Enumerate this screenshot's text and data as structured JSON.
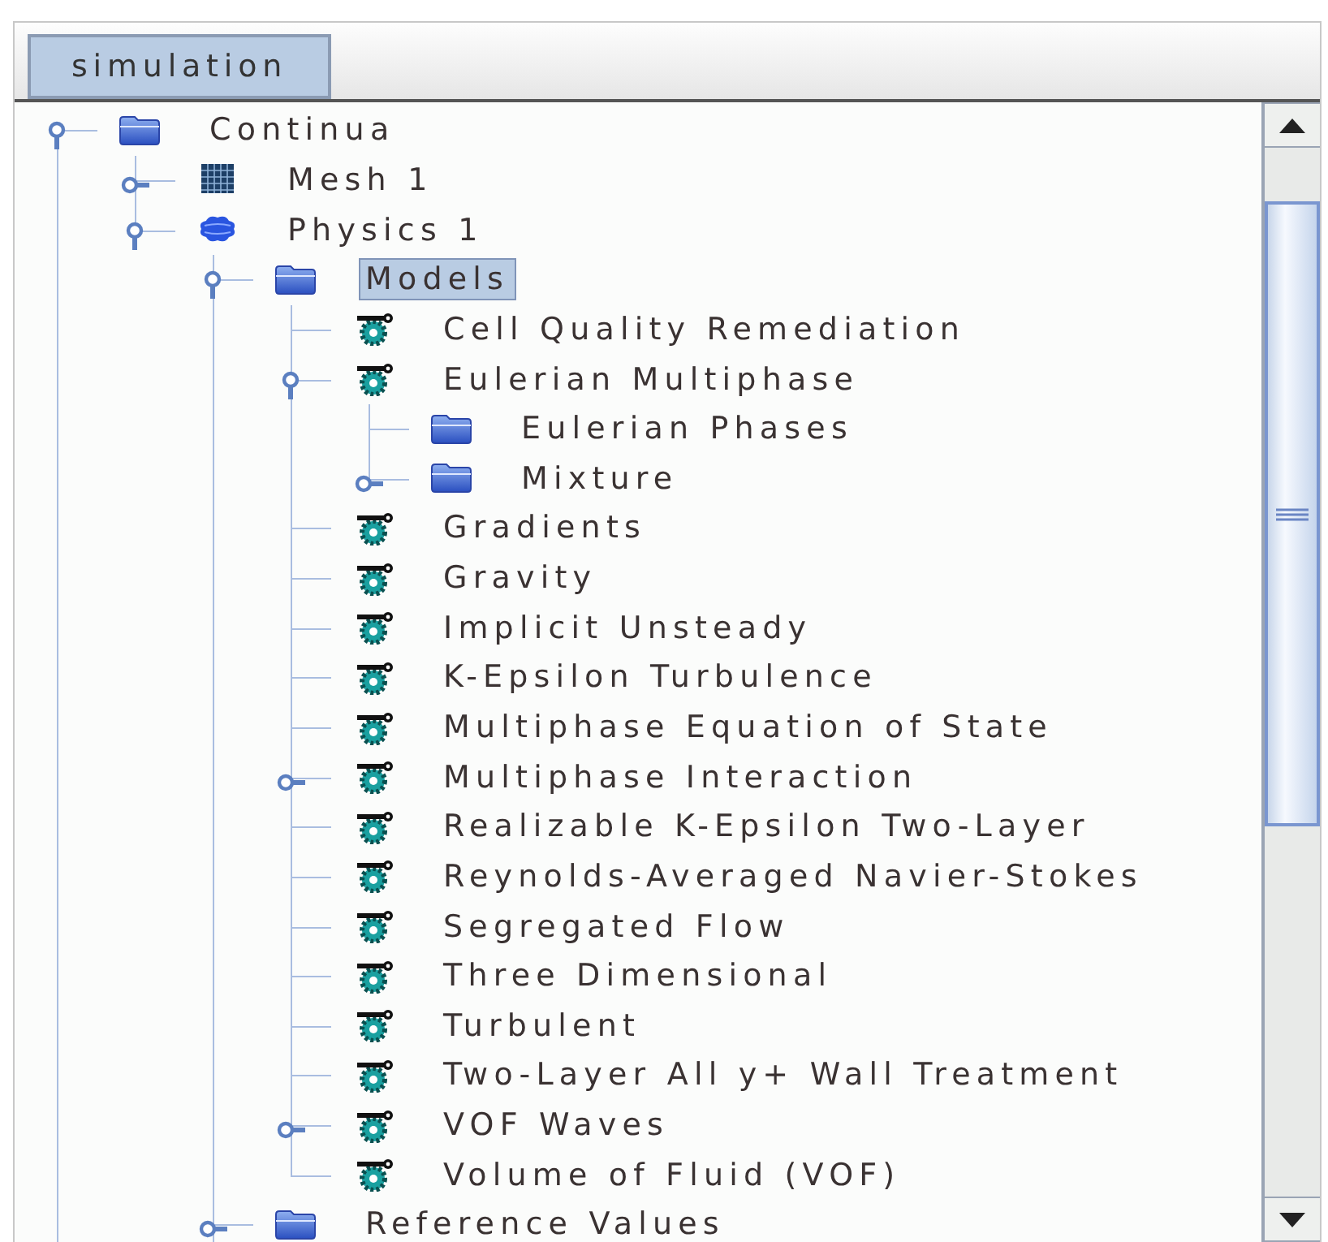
{
  "tabs": [
    {
      "label": "simulation",
      "selected": true
    }
  ],
  "tree": [
    {
      "label": "Continua",
      "kind": "folder",
      "selected": false,
      "expanded": true,
      "line_continues": true,
      "children": [
        {
          "label": "Mesh 1",
          "kind": "mesh",
          "selected": false,
          "expanded": false
        },
        {
          "label": "Physics 1",
          "kind": "physics",
          "selected": false,
          "expanded": true,
          "children": [
            {
              "label": "Models",
              "kind": "folder",
              "selected": true,
              "expanded": true,
              "children": [
                {
                  "label": "Cell Quality Remediation",
                  "kind": "model",
                  "selected": false
                },
                {
                  "label": "Eulerian Multiphase",
                  "kind": "model",
                  "selected": false,
                  "expanded": true,
                  "children": [
                    {
                      "label": "Eulerian Phases",
                      "kind": "folder",
                      "selected": false
                    },
                    {
                      "label": "Mixture",
                      "kind": "folder",
                      "selected": false,
                      "expanded": false
                    }
                  ]
                },
                {
                  "label": "Gradients",
                  "kind": "model",
                  "selected": false
                },
                {
                  "label": "Gravity",
                  "kind": "model",
                  "selected": false
                },
                {
                  "label": "Implicit Unsteady",
                  "kind": "model",
                  "selected": false
                },
                {
                  "label": "K-Epsilon Turbulence",
                  "kind": "model",
                  "selected": false
                },
                {
                  "label": "Multiphase Equation of State",
                  "kind": "model",
                  "selected": false
                },
                {
                  "label": "Multiphase Interaction",
                  "kind": "model",
                  "selected": false,
                  "expanded": false
                },
                {
                  "label": "Realizable K-Epsilon Two-Layer",
                  "kind": "model",
                  "selected": false
                },
                {
                  "label": "Reynolds-Averaged Navier-Stokes",
                  "kind": "model",
                  "selected": false
                },
                {
                  "label": "Segregated Flow",
                  "kind": "model",
                  "selected": false
                },
                {
                  "label": "Three Dimensional",
                  "kind": "model",
                  "selected": false
                },
                {
                  "label": "Turbulent",
                  "kind": "model",
                  "selected": false
                },
                {
                  "label": "Two-Layer All y+ Wall Treatment",
                  "kind": "model",
                  "selected": false
                },
                {
                  "label": "VOF Waves",
                  "kind": "model",
                  "selected": false,
                  "expanded": false
                },
                {
                  "label": "Volume of Fluid (VOF)",
                  "kind": "model",
                  "selected": false
                }
              ]
            },
            {
              "label": "Reference Values",
              "kind": "folder",
              "selected": false,
              "expanded": false,
              "line_continues": true
            }
          ]
        }
      ]
    }
  ]
}
